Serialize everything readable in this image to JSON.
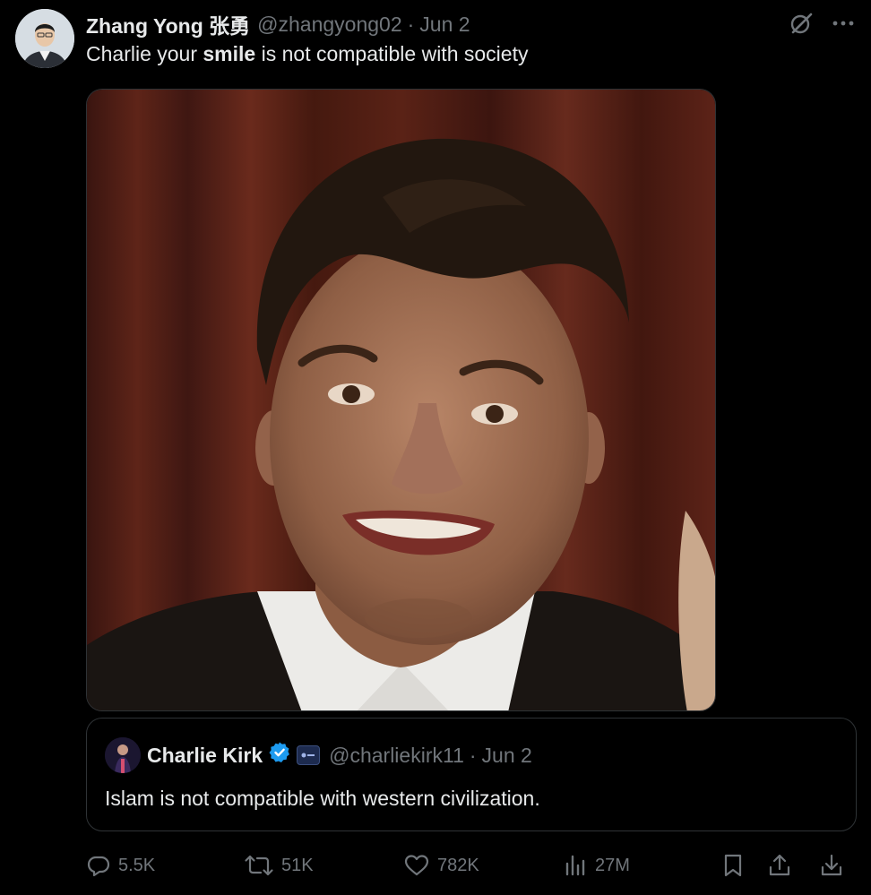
{
  "author": {
    "display_name": "Zhang Yong 张勇",
    "handle": "@zhangyong02",
    "separator": "·",
    "date": "Jun 2"
  },
  "tweet": {
    "text_before": "Charlie your ",
    "text_bold": "smile",
    "text_after": " is not compatible with society"
  },
  "top_icons": [
    "grok-icon",
    "more-icon"
  ],
  "quoted": {
    "display_name": "Charlie Kirk",
    "verified": true,
    "handle": "@charliekirk11",
    "separator": "·",
    "date": "Jun 2",
    "text": "Islam is not compatible with western civilization."
  },
  "actions": {
    "replies": "5.5K",
    "reposts": "51K",
    "likes": "782K",
    "views": "27M"
  },
  "colors": {
    "background": "#000000",
    "text_primary": "#e7e9ea",
    "text_secondary": "#71767b",
    "border": "#2f3336",
    "verified_blue": "#1d9bf0"
  }
}
